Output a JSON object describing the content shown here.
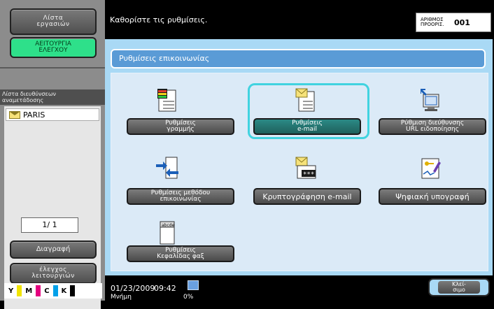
{
  "sidebar": {
    "job_list_line1": "Λίστα",
    "job_list_line2": "εργασιών",
    "check_function_line1": "ΑΕΙΤΟΥΡΓΙΑ",
    "check_function_line2": "ΕΛΕΓΧΟΥ",
    "dest_header_line1": "Λίστα διευθύνσεων",
    "dest_header_line2": "αναμετάδοσης",
    "dest_item": "PARIS",
    "page_indicator": "1/  1",
    "delete_label": "Διαγραφή",
    "check_details_line1": "έλεγχος",
    "check_details_line2": "λειτουργιών",
    "toner": [
      "Y",
      "M",
      "C",
      "K"
    ]
  },
  "message": "Καθορίστε τις ρυθμίσεις.",
  "copies": {
    "label_line1": "ΑΡΙΘΜΟΣ",
    "label_line2": "ΠΡΟΟΡΙΣ.",
    "value": "001"
  },
  "main": {
    "header": "Ρυθμίσεις επικοινωνίας",
    "buttons": {
      "line_settings_l1": "Ρυθμίσεις",
      "line_settings_l2": "γραμμής",
      "email_settings_l1": "Ρυθμίσεις",
      "email_settings_l2": "e-mail",
      "url_notify_l1": "Ρύθμιση διεύθυνσης",
      "url_notify_l2": "URL ειδοποίησης",
      "comm_method_l1": "Ρυθμίσεις μεθόδου",
      "comm_method_l2": "επικοινωνίας",
      "email_encryption": "Κρυπτογράφηση e-mail",
      "digital_signature": "Ψηφιακή υπογραφή",
      "fax_header_l1": "Ρυθμίσεις",
      "fax_header_l2": "Κεφαλίδας φαξ"
    },
    "fax_icon_text": "abcde"
  },
  "footer": {
    "date": "01/23/2009",
    "time": "09:42",
    "memory_label": "Μνήμη",
    "memory_value": "0%",
    "close_l1": "Κλεί-",
    "close_l2": "σιμο"
  },
  "colors": {
    "selected_ring": "#41d3e0",
    "panel_bg": "#a9d9f5",
    "header_bg": "#5a9bd6",
    "check_function_bg": "#2ee08a",
    "toner_y": "#f1e400",
    "toner_m": "#e4007f",
    "toner_c": "#00a0e9",
    "toner_k": "#000000"
  }
}
